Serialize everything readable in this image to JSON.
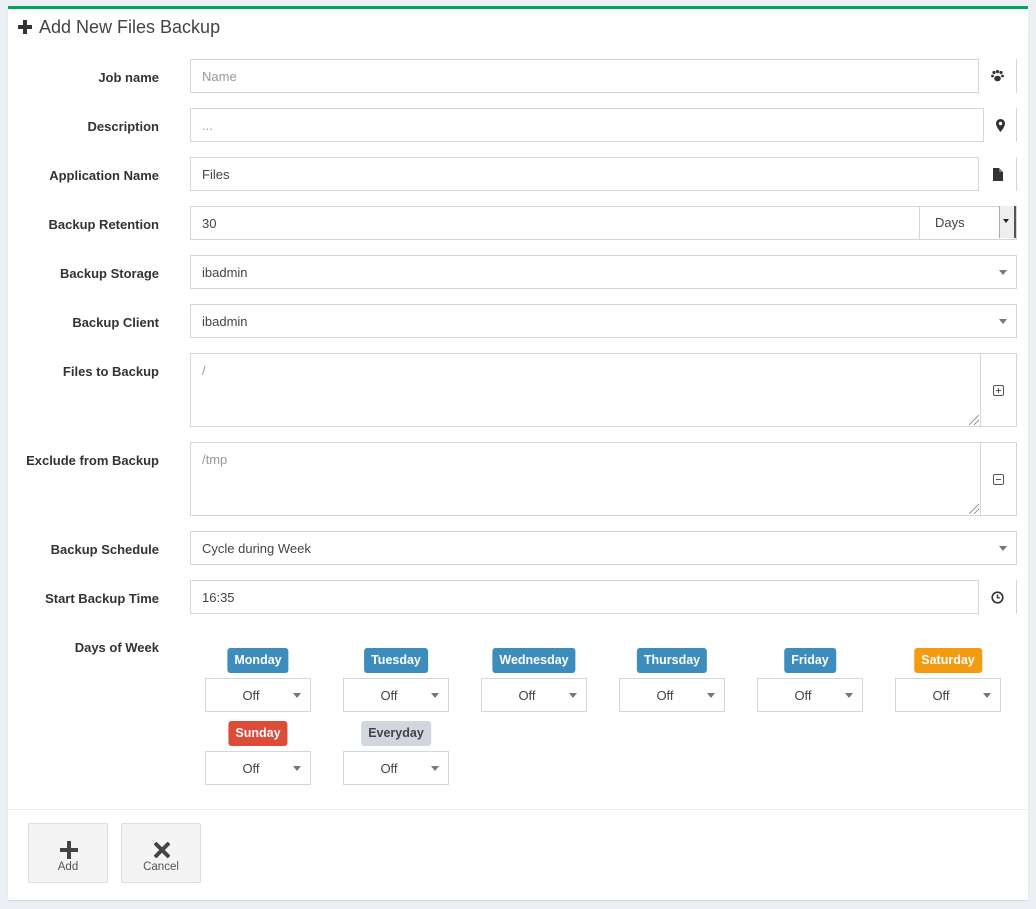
{
  "header": {
    "title": "Add New Files Backup",
    "icon": "plus-icon"
  },
  "form": {
    "job_name": {
      "label": "Job name",
      "placeholder": "Name",
      "icon": "paw-icon"
    },
    "description": {
      "label": "Description",
      "placeholder": "...",
      "icon": "map-marker-icon"
    },
    "application_name": {
      "label": "Application Name",
      "value": "Files",
      "icon": "file-icon"
    },
    "backup_retention": {
      "label": "Backup Retention",
      "value": "30",
      "unit": "Days"
    },
    "backup_storage": {
      "label": "Backup Storage",
      "value": "ibadmin"
    },
    "backup_client": {
      "label": "Backup Client",
      "value": "ibadmin"
    },
    "files_to_backup": {
      "label": "Files to Backup",
      "placeholder": "/",
      "icon": "plus-square-icon"
    },
    "exclude_from_backup": {
      "label": "Exclude from Backup",
      "placeholder": "/tmp",
      "icon": "minus-square-icon"
    },
    "backup_schedule": {
      "label": "Backup Schedule",
      "value": "Cycle during Week"
    },
    "start_backup_time": {
      "label": "Start Backup Time",
      "value": "16:35",
      "icon": "clock-icon"
    },
    "days_of_week": {
      "label": "Days of Week",
      "days": [
        {
          "name": "Monday",
          "value": "Off",
          "color": "#3c8dbc"
        },
        {
          "name": "Tuesday",
          "value": "Off",
          "color": "#3c8dbc"
        },
        {
          "name": "Wednesday",
          "value": "Off",
          "color": "#3c8dbc"
        },
        {
          "name": "Thursday",
          "value": "Off",
          "color": "#3c8dbc"
        },
        {
          "name": "Friday",
          "value": "Off",
          "color": "#3c8dbc"
        },
        {
          "name": "Saturday",
          "value": "Off",
          "color": "#f39c12"
        },
        {
          "name": "Sunday",
          "value": "Off",
          "color": "#dd4b39"
        },
        {
          "name": "Everyday",
          "value": "Off",
          "color": "#d2d6de"
        }
      ]
    }
  },
  "footer": {
    "add_label": "Add",
    "cancel_label": "Cancel"
  },
  "colors": {
    "accent": "#00a65a",
    "primary": "#3c8dbc",
    "warning": "#f39c12",
    "danger": "#dd4b39"
  }
}
